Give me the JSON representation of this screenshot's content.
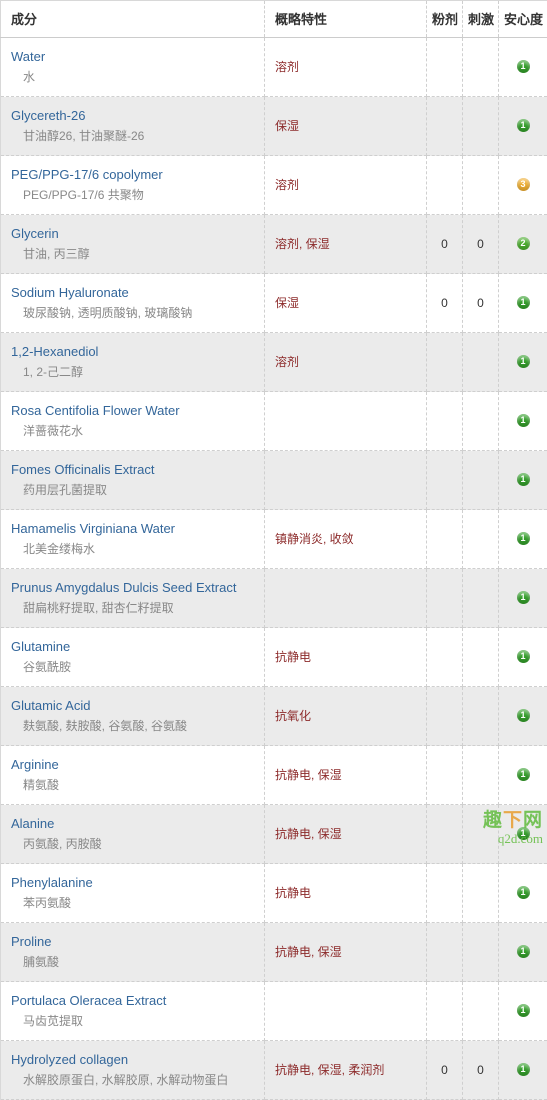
{
  "table": {
    "columns": [
      {
        "key": "name",
        "label": "成分"
      },
      {
        "key": "prop",
        "label": "概略特性"
      },
      {
        "key": "powder",
        "label": "粉剂"
      },
      {
        "key": "irrit",
        "label": "刺激"
      },
      {
        "key": "safe",
        "label": "安心度"
      }
    ],
    "rows": [
      {
        "name_en": "Water",
        "name_cn": "水",
        "prop": "溶剂",
        "powder": "",
        "irrit": "",
        "safe": "1",
        "safe_level": "lv1"
      },
      {
        "name_en": "Glycereth-26",
        "name_cn": "甘油醇26, 甘油聚醚-26",
        "prop": "保湿",
        "powder": "",
        "irrit": "",
        "safe": "1",
        "safe_level": "lv1"
      },
      {
        "name_en": "PEG/PPG-17/6 copolymer",
        "name_cn": "PEG/PPG-17/6 共聚物",
        "prop": "溶剂",
        "powder": "",
        "irrit": "",
        "safe": "3",
        "safe_level": "lv3"
      },
      {
        "name_en": "Glycerin",
        "name_cn": "甘油, 丙三醇",
        "prop": "溶剂, 保湿",
        "powder": "0",
        "irrit": "0",
        "safe": "2",
        "safe_level": "lv2"
      },
      {
        "name_en": "Sodium Hyaluronate",
        "name_cn": "玻尿酸钠, 透明质酸钠, 玻璃酸钠",
        "prop": "保湿",
        "powder": "0",
        "irrit": "0",
        "safe": "1",
        "safe_level": "lv1"
      },
      {
        "name_en": "1,2-Hexanediol",
        "name_cn": "1, 2-己二醇",
        "prop": "溶剂",
        "powder": "",
        "irrit": "",
        "safe": "1",
        "safe_level": "lv1"
      },
      {
        "name_en": "Rosa Centifolia Flower Water",
        "name_cn": "洋蔷薇花水",
        "prop": "",
        "powder": "",
        "irrit": "",
        "safe": "1",
        "safe_level": "lv1"
      },
      {
        "name_en": "Fomes Officinalis Extract",
        "name_cn": "药用层孔菌提取",
        "prop": "",
        "powder": "",
        "irrit": "",
        "safe": "1",
        "safe_level": "lv1"
      },
      {
        "name_en": "Hamamelis Virginiana Water",
        "name_cn": "北美金缕梅水",
        "prop": "镇静消炎, 收敛",
        "powder": "",
        "irrit": "",
        "safe": "1",
        "safe_level": "lv1"
      },
      {
        "name_en": "Prunus Amygdalus Dulcis Seed Extract",
        "name_cn": "甜扁桃籽提取, 甜杏仁籽提取",
        "prop": "",
        "powder": "",
        "irrit": "",
        "safe": "1",
        "safe_level": "lv1"
      },
      {
        "name_en": "Glutamine",
        "name_cn": "谷氨酰胺",
        "prop": "抗静电",
        "powder": "",
        "irrit": "",
        "safe": "1",
        "safe_level": "lv1"
      },
      {
        "name_en": "Glutamic Acid",
        "name_cn": "麸氨酸, 麸胺酸, 谷氨酸, 谷氨酸",
        "prop": "抗氧化",
        "powder": "",
        "irrit": "",
        "safe": "1",
        "safe_level": "lv1"
      },
      {
        "name_en": "Arginine",
        "name_cn": "精氨酸",
        "prop": "抗静电, 保湿",
        "powder": "",
        "irrit": "",
        "safe": "1",
        "safe_level": "lv1"
      },
      {
        "name_en": "Alanine",
        "name_cn": "丙氨酸, 丙胺酸",
        "prop": "抗静电, 保湿",
        "powder": "",
        "irrit": "",
        "safe": "1",
        "safe_level": "lv1"
      },
      {
        "name_en": "Phenylalanine",
        "name_cn": "苯丙氨酸",
        "prop": "抗静电",
        "powder": "",
        "irrit": "",
        "safe": "1",
        "safe_level": "lv1"
      },
      {
        "name_en": "Proline",
        "name_cn": "脯氨酸",
        "prop": "抗静电, 保湿",
        "powder": "",
        "irrit": "",
        "safe": "1",
        "safe_level": "lv1"
      },
      {
        "name_en": "Portulaca Oleracea Extract",
        "name_cn": "马齿苋提取",
        "prop": "",
        "powder": "",
        "irrit": "",
        "safe": "1",
        "safe_level": "lv1"
      },
      {
        "name_en": "Hydrolyzed collagen",
        "name_cn": "水解胶原蛋白, 水解胶原, 水解动物蛋白",
        "prop": "抗静电, 保湿, 柔润剂",
        "powder": "0",
        "irrit": "0",
        "safe": "1",
        "safe_level": "lv1"
      }
    ]
  },
  "watermark": {
    "line1_a": "趣",
    "line1_b": "下",
    "line1_c": "网",
    "line2": "q2d.com"
  },
  "colors": {
    "link": "#33669a",
    "property_text": "#8c2a2a",
    "secondary_text": "#888888",
    "alt_row_bg": "#ebebeb",
    "border": "#cfcfcf",
    "badge_green": "#35a02c",
    "badge_orange": "#f2b134",
    "watermark_green": "#6cbf4b"
  }
}
